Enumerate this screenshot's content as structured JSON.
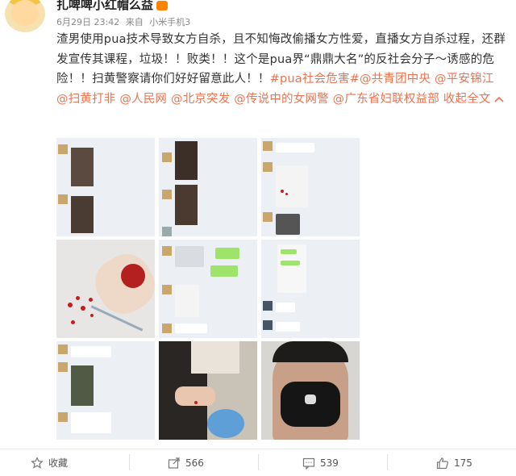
{
  "author": {
    "name": "扎啤啤小红帽么益"
  },
  "meta": {
    "date": "6月29日 23:42",
    "source_prefix": "来自",
    "device": "小米手机3"
  },
  "post": {
    "text_main": "渣男使用pua技术导致女方自杀，且不知悔改偷播女方性爱，直播女方自杀过程，还群发宣传其课程，垃圾！！败类！！这个是pua界“鼎鼎大名”的反社会分子～诱感的危险！！扫黄警察请你们好好留意此人！！",
    "tag_text": "#pua社会危害#",
    "mentions": [
      "@共青团中央",
      "@平安锦江",
      "@扫黄打非",
      "@人民网",
      "@北京突发",
      "@传说中的女网警",
      "@广东省妇联权益部"
    ],
    "collapse_label": "收起全文"
  },
  "colors": {
    "accent": "#eb7350",
    "meta": "#888888",
    "text": "#333333"
  },
  "images": [
    {
      "name": "chat-screenshot-selfies"
    },
    {
      "name": "chat-screenshot-photos"
    },
    {
      "name": "chat-screenshot-blood"
    },
    {
      "name": "bleeding-wrist-photo"
    },
    {
      "name": "chat-screenshot-green"
    },
    {
      "name": "chat-screenshot-contacts"
    },
    {
      "name": "chat-screenshot-video"
    },
    {
      "name": "cutting-photo"
    },
    {
      "name": "masked-man-selfie"
    }
  ],
  "footer": {
    "favorite_label": "收藏",
    "share_count": "566",
    "comment_count": "539",
    "like_count": "175"
  }
}
